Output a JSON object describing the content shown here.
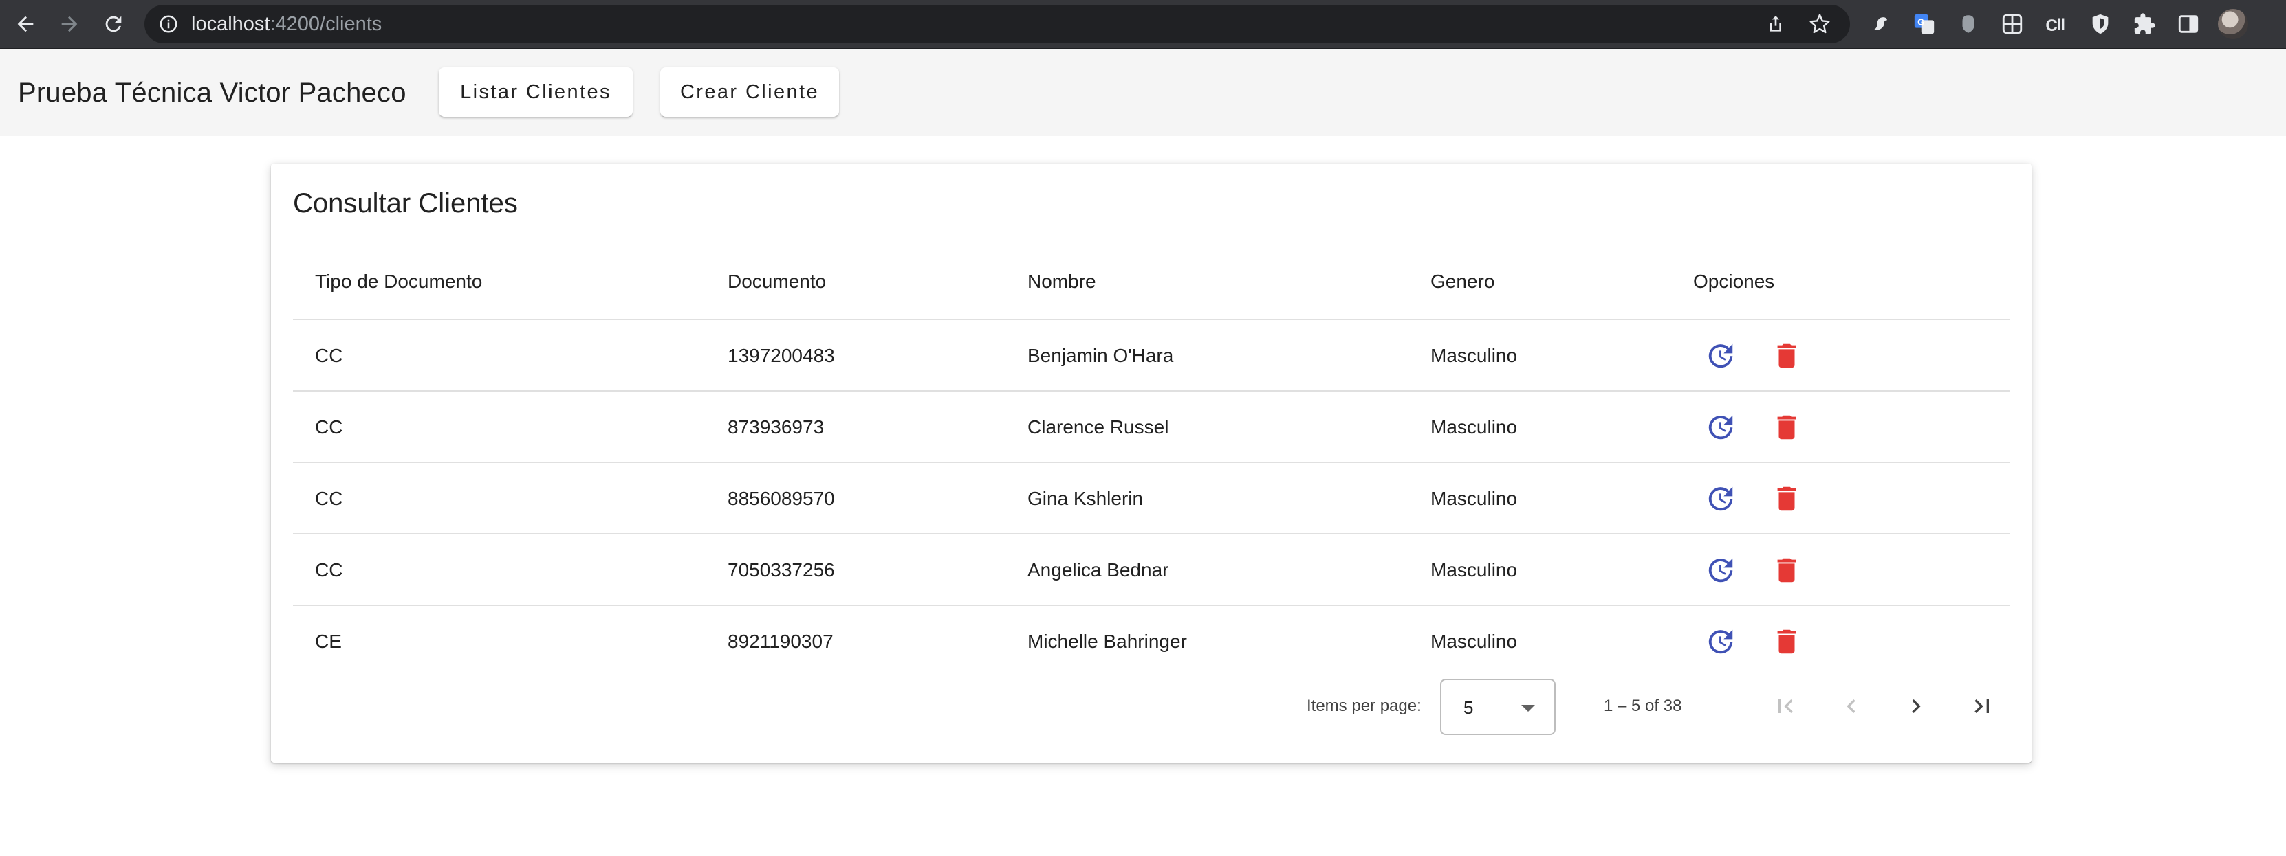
{
  "browser": {
    "url_host": "localhost",
    "url_path": ":4200/clients",
    "icons": [
      "back-arrow-icon",
      "forward-arrow-icon",
      "reload-icon",
      "site-info-icon",
      "share-icon",
      "bookmark-star-icon",
      "extension-icons",
      "puzzle-icon",
      "side-panel-icon",
      "profile-avatar"
    ]
  },
  "toolbar": {
    "title": "Prueba Técnica Victor Pacheco",
    "list_button": "Listar Clientes",
    "create_button": "Crear Cliente"
  },
  "card": {
    "title": "Consultar Clientes",
    "columns": [
      "Tipo de Documento",
      "Documento",
      "Nombre",
      "Genero",
      "Opciones"
    ],
    "rows": [
      {
        "tipo": "CC",
        "documento": "1397200483",
        "nombre": "Benjamin O'Hara",
        "genero": "Masculino"
      },
      {
        "tipo": "CC",
        "documento": "873936973",
        "nombre": "Clarence Russel",
        "genero": "Masculino"
      },
      {
        "tipo": "CC",
        "documento": "8856089570",
        "nombre": "Gina Kshlerin",
        "genero": "Masculino"
      },
      {
        "tipo": "CC",
        "documento": "7050337256",
        "nombre": "Angelica Bednar",
        "genero": "Masculino"
      },
      {
        "tipo": "CE",
        "documento": "8921190307",
        "nombre": "Michelle Bahringer",
        "genero": "Masculino"
      }
    ],
    "row_actions": [
      "update-icon",
      "delete-icon"
    ]
  },
  "paginator": {
    "items_per_page_label": "Items per page:",
    "page_size": "5",
    "range_label": "1 – 5 of 38",
    "first_enabled": false,
    "previous_enabled": false,
    "next_enabled": true,
    "last_enabled": true
  },
  "colors": {
    "toolbar_bg": "#f5f5f5",
    "update_icon": "#3f51b5",
    "delete_icon": "#e53935",
    "chrome_bg": "#35363a",
    "omnibox_bg": "#202124"
  }
}
